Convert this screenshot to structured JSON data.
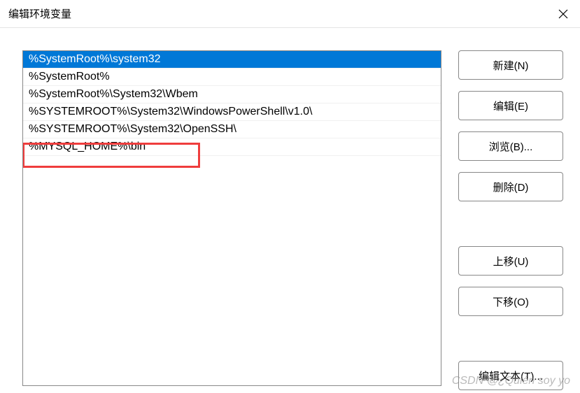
{
  "title": "编辑环境变量",
  "list": {
    "items": [
      "%SystemRoot%\\system32",
      "%SystemRoot%",
      "%SystemRoot%\\System32\\Wbem",
      "%SYSTEMROOT%\\System32\\WindowsPowerShell\\v1.0\\",
      "%SYSTEMROOT%\\System32\\OpenSSH\\",
      "%MYSQL_HOME%\\bin"
    ],
    "selected_index": 0,
    "highlighted_index": 5
  },
  "buttons": {
    "new": "新建(N)",
    "edit": "编辑(E)",
    "browse": "浏览(B)...",
    "delete": "删除(D)",
    "moveup": "上移(U)",
    "movedown": "下移(O)",
    "edittext": "编辑文本(T)..."
  },
  "watermark": "CSDN @¿Quién soy yo"
}
